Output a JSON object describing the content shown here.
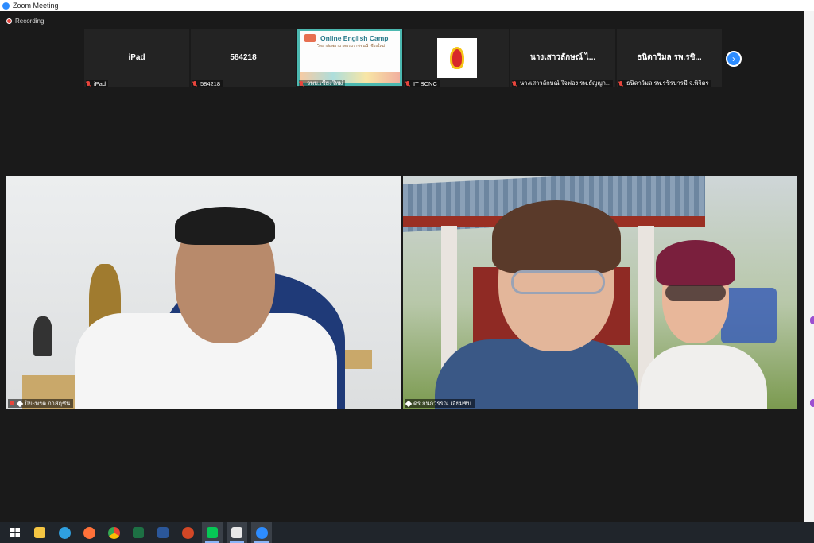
{
  "window": {
    "title": "Zoom Meeting"
  },
  "recording": {
    "label": "Recording"
  },
  "gallery_strip": [
    {
      "big_name": "iPad",
      "label": "iPad",
      "kind": "name"
    },
    {
      "big_name": "584218",
      "label": "584218",
      "kind": "name"
    },
    {
      "big_name": "",
      "label": "วพบ.เชียงใหม่",
      "kind": "camp",
      "camp_title": "Online English Camp",
      "camp_sub": "วิทยาลัยพยาบาลบรมราชชนนี เชียงใหม่"
    },
    {
      "big_name": "",
      "label": "IT BCNC",
      "kind": "logo"
    },
    {
      "big_name": "นางเสาวลักษณ์ ไ...",
      "label": "นางเสาวลักษณ์ ใจฟอง รพ.ธัญญา...",
      "kind": "name"
    },
    {
      "big_name": "ธนิดาวิมล รพ.รชิ...",
      "label": "ธนิดาวิมล รพ.รชิรบารมี จ.พิจิตร",
      "kind": "name"
    }
  ],
  "next_page_icon": "chevron-right-icon",
  "videos": [
    {
      "label": "ปิยะพรต กาสฤชัน",
      "muted": true,
      "pinned": true
    },
    {
      "label": "ดร.กนกวรรณ เอี่ยมชับ",
      "muted": false,
      "pinned": true
    }
  ],
  "taskbar": {
    "items": [
      {
        "name": "start-icon",
        "color": "#ffffff",
        "active": false
      },
      {
        "name": "file-explorer-icon",
        "color": "#f4c542",
        "active": false
      },
      {
        "name": "edge-icon",
        "color": "#2fa0e0",
        "active": false
      },
      {
        "name": "firefox-icon",
        "color": "#ff7139",
        "active": false
      },
      {
        "name": "chrome-icon",
        "color": "#4caf50",
        "active": false
      },
      {
        "name": "excel-icon",
        "color": "#1d7044",
        "active": false
      },
      {
        "name": "word-icon",
        "color": "#2b579a",
        "active": false
      },
      {
        "name": "powerpoint-icon",
        "color": "#d24726",
        "active": false
      },
      {
        "name": "line-icon",
        "color": "#06c755",
        "active": true
      },
      {
        "name": "acrobat-icon",
        "color": "#e8e8e8",
        "active": true
      },
      {
        "name": "zoom-icon",
        "color": "#2d8cff",
        "active": true
      }
    ]
  },
  "colors": {
    "zoom_blue": "#2d8cff",
    "mute_red": "#e8453c",
    "panel_purple": "#9b4fd1"
  }
}
